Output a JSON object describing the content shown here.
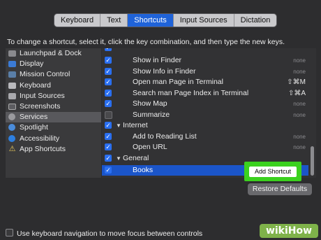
{
  "tabs": [
    "Keyboard",
    "Text",
    "Shortcuts",
    "Input Sources",
    "Dictation"
  ],
  "active_tab": "Shortcuts",
  "instructions": "To change a shortcut, select it, click the key combination, and then type the new keys.",
  "categories": [
    {
      "label": "Launchpad & Dock",
      "icon": "launchpad-icon"
    },
    {
      "label": "Display",
      "icon": "display-icon"
    },
    {
      "label": "Mission Control",
      "icon": "mission-control-icon"
    },
    {
      "label": "Keyboard",
      "icon": "keyboard-icon"
    },
    {
      "label": "Input Sources",
      "icon": "input-sources-icon"
    },
    {
      "label": "Screenshots",
      "icon": "screenshots-icon"
    },
    {
      "label": "Services",
      "icon": "services-gear-icon",
      "selected": true
    },
    {
      "label": "Spotlight",
      "icon": "spotlight-icon"
    },
    {
      "label": "Accessibility",
      "icon": "accessibility-icon"
    },
    {
      "label": "App Shortcuts",
      "icon": "app-shortcuts-icon"
    }
  ],
  "shortcuts": [
    {
      "label": "",
      "key": "",
      "checked": true
    },
    {
      "label": "Show in Finder",
      "key": "none",
      "checked": true
    },
    {
      "label": "Show Info in Finder",
      "key": "none",
      "checked": true
    },
    {
      "label": "Open man Page in Terminal",
      "key": "⇧⌘M",
      "checked": true
    },
    {
      "label": "Search man Page Index in Terminal",
      "key": "⇧⌘A",
      "checked": true
    },
    {
      "label": "Show Map",
      "key": "none",
      "checked": true
    },
    {
      "label": "Summarize",
      "key": "none",
      "checked": false
    },
    {
      "label": "Internet",
      "key": "",
      "checked": true,
      "group": true
    },
    {
      "label": "Add to Reading List",
      "key": "none",
      "checked": true
    },
    {
      "label": "Open URL",
      "key": "none",
      "checked": true
    },
    {
      "label": "General",
      "key": "",
      "checked": true,
      "group": true
    },
    {
      "label": "Books",
      "key": "",
      "checked": true,
      "selected": true
    }
  ],
  "add_shortcut_label": "Add Shortcut",
  "restore_label": "Restore Defaults",
  "footer_label": "Use keyboard navigation to move focus between controls",
  "watermark": "wikiHow",
  "colors": {
    "accent": "#1f63d9",
    "highlight": "#3bd11e",
    "selection": "#1b55c9"
  }
}
